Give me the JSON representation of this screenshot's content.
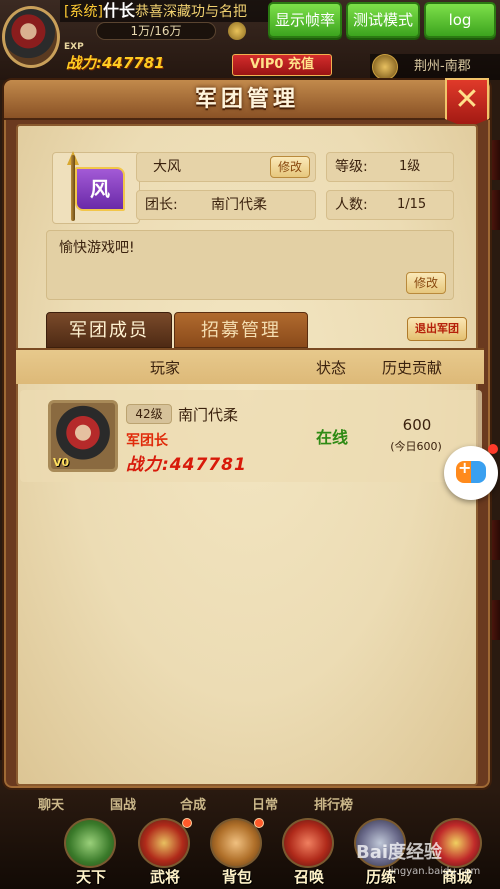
{
  "topbar": {
    "ticker_tag": "[系统]",
    "ticker_rank": "什长",
    "ticker_text": "恭喜深藏功与名把",
    "exp_label": "EXP",
    "exp_value": "1万/16万",
    "power_label": "战力:447781",
    "vip_label": "VIP0",
    "recharge_label": "充值",
    "region": "荆州-南郡"
  },
  "debug": {
    "fps_label": "显示帧率",
    "test_mode_label": "测试模式",
    "log_label": "log"
  },
  "modal": {
    "title": "军团管理",
    "close_label": "✕"
  },
  "legion": {
    "emblem_char": "风",
    "name": "大风",
    "edit_label": "修改",
    "level_label": "等级:",
    "level_value": "1级",
    "leader_label": "团长:",
    "leader_value": "南门代柔",
    "members_label": "人数:",
    "members_value": "1/15",
    "notice": "愉快游戏吧!",
    "notice_edit_label": "修改"
  },
  "tabs": [
    {
      "label": "军团成员",
      "active": true
    },
    {
      "label": "招募管理",
      "active": false
    }
  ],
  "quit_label": "退出军团",
  "table": {
    "headers": [
      "玩家",
      "状态",
      "历史贡献"
    ],
    "rows": [
      {
        "level": "42级",
        "name": "南门代柔",
        "role": "军团长",
        "power": "战力:447781",
        "vip": "V0",
        "status": "在线",
        "contribution": "600",
        "today": "(今日600)"
      }
    ]
  },
  "sub_labels": [
    "聊天",
    "国战",
    "合成",
    "日常",
    "排行榜"
  ],
  "nav": [
    {
      "label": "天下",
      "icon": "world-map-icon",
      "badge": false
    },
    {
      "label": "武将",
      "icon": "general-helmet-icon",
      "badge": true
    },
    {
      "label": "背包",
      "icon": "backpack-icon",
      "badge": true
    },
    {
      "label": "召唤",
      "icon": "summon-gate-icon",
      "badge": false
    },
    {
      "label": "历练",
      "icon": "training-icon",
      "badge": false
    },
    {
      "label": "商城",
      "icon": "shop-icon",
      "badge": false
    }
  ],
  "watermark": {
    "text": "Bai度经验",
    "url": "jingyan.baidu.com"
  },
  "colors": {
    "parchment": "#ecdcb4",
    "frame": "#6b3a1f",
    "online": "#2e8a14",
    "power_red": "#d81a0a",
    "debug_green": "#3ca41e"
  }
}
